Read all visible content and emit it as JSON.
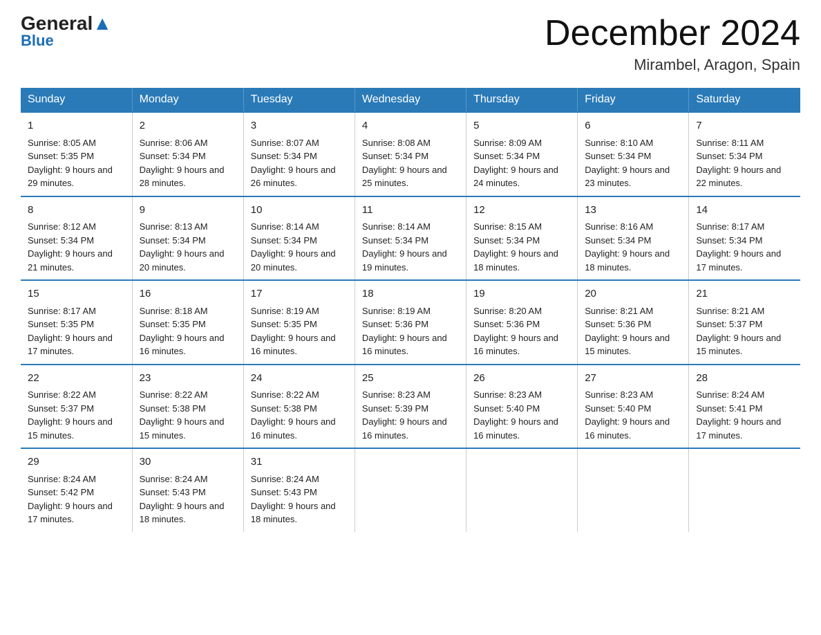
{
  "logo": {
    "general": "General",
    "blue": "Blue"
  },
  "title": "December 2024",
  "location": "Mirambel, Aragon, Spain",
  "days_of_week": [
    "Sunday",
    "Monday",
    "Tuesday",
    "Wednesday",
    "Thursday",
    "Friday",
    "Saturday"
  ],
  "weeks": [
    [
      {
        "day": "1",
        "sunrise": "8:05 AM",
        "sunset": "5:35 PM",
        "daylight": "9 hours and 29 minutes."
      },
      {
        "day": "2",
        "sunrise": "8:06 AM",
        "sunset": "5:34 PM",
        "daylight": "9 hours and 28 minutes."
      },
      {
        "day": "3",
        "sunrise": "8:07 AM",
        "sunset": "5:34 PM",
        "daylight": "9 hours and 26 minutes."
      },
      {
        "day": "4",
        "sunrise": "8:08 AM",
        "sunset": "5:34 PM",
        "daylight": "9 hours and 25 minutes."
      },
      {
        "day": "5",
        "sunrise": "8:09 AM",
        "sunset": "5:34 PM",
        "daylight": "9 hours and 24 minutes."
      },
      {
        "day": "6",
        "sunrise": "8:10 AM",
        "sunset": "5:34 PM",
        "daylight": "9 hours and 23 minutes."
      },
      {
        "day": "7",
        "sunrise": "8:11 AM",
        "sunset": "5:34 PM",
        "daylight": "9 hours and 22 minutes."
      }
    ],
    [
      {
        "day": "8",
        "sunrise": "8:12 AM",
        "sunset": "5:34 PM",
        "daylight": "9 hours and 21 minutes."
      },
      {
        "day": "9",
        "sunrise": "8:13 AM",
        "sunset": "5:34 PM",
        "daylight": "9 hours and 20 minutes."
      },
      {
        "day": "10",
        "sunrise": "8:14 AM",
        "sunset": "5:34 PM",
        "daylight": "9 hours and 20 minutes."
      },
      {
        "day": "11",
        "sunrise": "8:14 AM",
        "sunset": "5:34 PM",
        "daylight": "9 hours and 19 minutes."
      },
      {
        "day": "12",
        "sunrise": "8:15 AM",
        "sunset": "5:34 PM",
        "daylight": "9 hours and 18 minutes."
      },
      {
        "day": "13",
        "sunrise": "8:16 AM",
        "sunset": "5:34 PM",
        "daylight": "9 hours and 18 minutes."
      },
      {
        "day": "14",
        "sunrise": "8:17 AM",
        "sunset": "5:34 PM",
        "daylight": "9 hours and 17 minutes."
      }
    ],
    [
      {
        "day": "15",
        "sunrise": "8:17 AM",
        "sunset": "5:35 PM",
        "daylight": "9 hours and 17 minutes."
      },
      {
        "day": "16",
        "sunrise": "8:18 AM",
        "sunset": "5:35 PM",
        "daylight": "9 hours and 16 minutes."
      },
      {
        "day": "17",
        "sunrise": "8:19 AM",
        "sunset": "5:35 PM",
        "daylight": "9 hours and 16 minutes."
      },
      {
        "day": "18",
        "sunrise": "8:19 AM",
        "sunset": "5:36 PM",
        "daylight": "9 hours and 16 minutes."
      },
      {
        "day": "19",
        "sunrise": "8:20 AM",
        "sunset": "5:36 PM",
        "daylight": "9 hours and 16 minutes."
      },
      {
        "day": "20",
        "sunrise": "8:21 AM",
        "sunset": "5:36 PM",
        "daylight": "9 hours and 15 minutes."
      },
      {
        "day": "21",
        "sunrise": "8:21 AM",
        "sunset": "5:37 PM",
        "daylight": "9 hours and 15 minutes."
      }
    ],
    [
      {
        "day": "22",
        "sunrise": "8:22 AM",
        "sunset": "5:37 PM",
        "daylight": "9 hours and 15 minutes."
      },
      {
        "day": "23",
        "sunrise": "8:22 AM",
        "sunset": "5:38 PM",
        "daylight": "9 hours and 15 minutes."
      },
      {
        "day": "24",
        "sunrise": "8:22 AM",
        "sunset": "5:38 PM",
        "daylight": "9 hours and 16 minutes."
      },
      {
        "day": "25",
        "sunrise": "8:23 AM",
        "sunset": "5:39 PM",
        "daylight": "9 hours and 16 minutes."
      },
      {
        "day": "26",
        "sunrise": "8:23 AM",
        "sunset": "5:40 PM",
        "daylight": "9 hours and 16 minutes."
      },
      {
        "day": "27",
        "sunrise": "8:23 AM",
        "sunset": "5:40 PM",
        "daylight": "9 hours and 16 minutes."
      },
      {
        "day": "28",
        "sunrise": "8:24 AM",
        "sunset": "5:41 PM",
        "daylight": "9 hours and 17 minutes."
      }
    ],
    [
      {
        "day": "29",
        "sunrise": "8:24 AM",
        "sunset": "5:42 PM",
        "daylight": "9 hours and 17 minutes."
      },
      {
        "day": "30",
        "sunrise": "8:24 AM",
        "sunset": "5:43 PM",
        "daylight": "9 hours and 18 minutes."
      },
      {
        "day": "31",
        "sunrise": "8:24 AM",
        "sunset": "5:43 PM",
        "daylight": "9 hours and 18 minutes."
      },
      null,
      null,
      null,
      null
    ]
  ]
}
